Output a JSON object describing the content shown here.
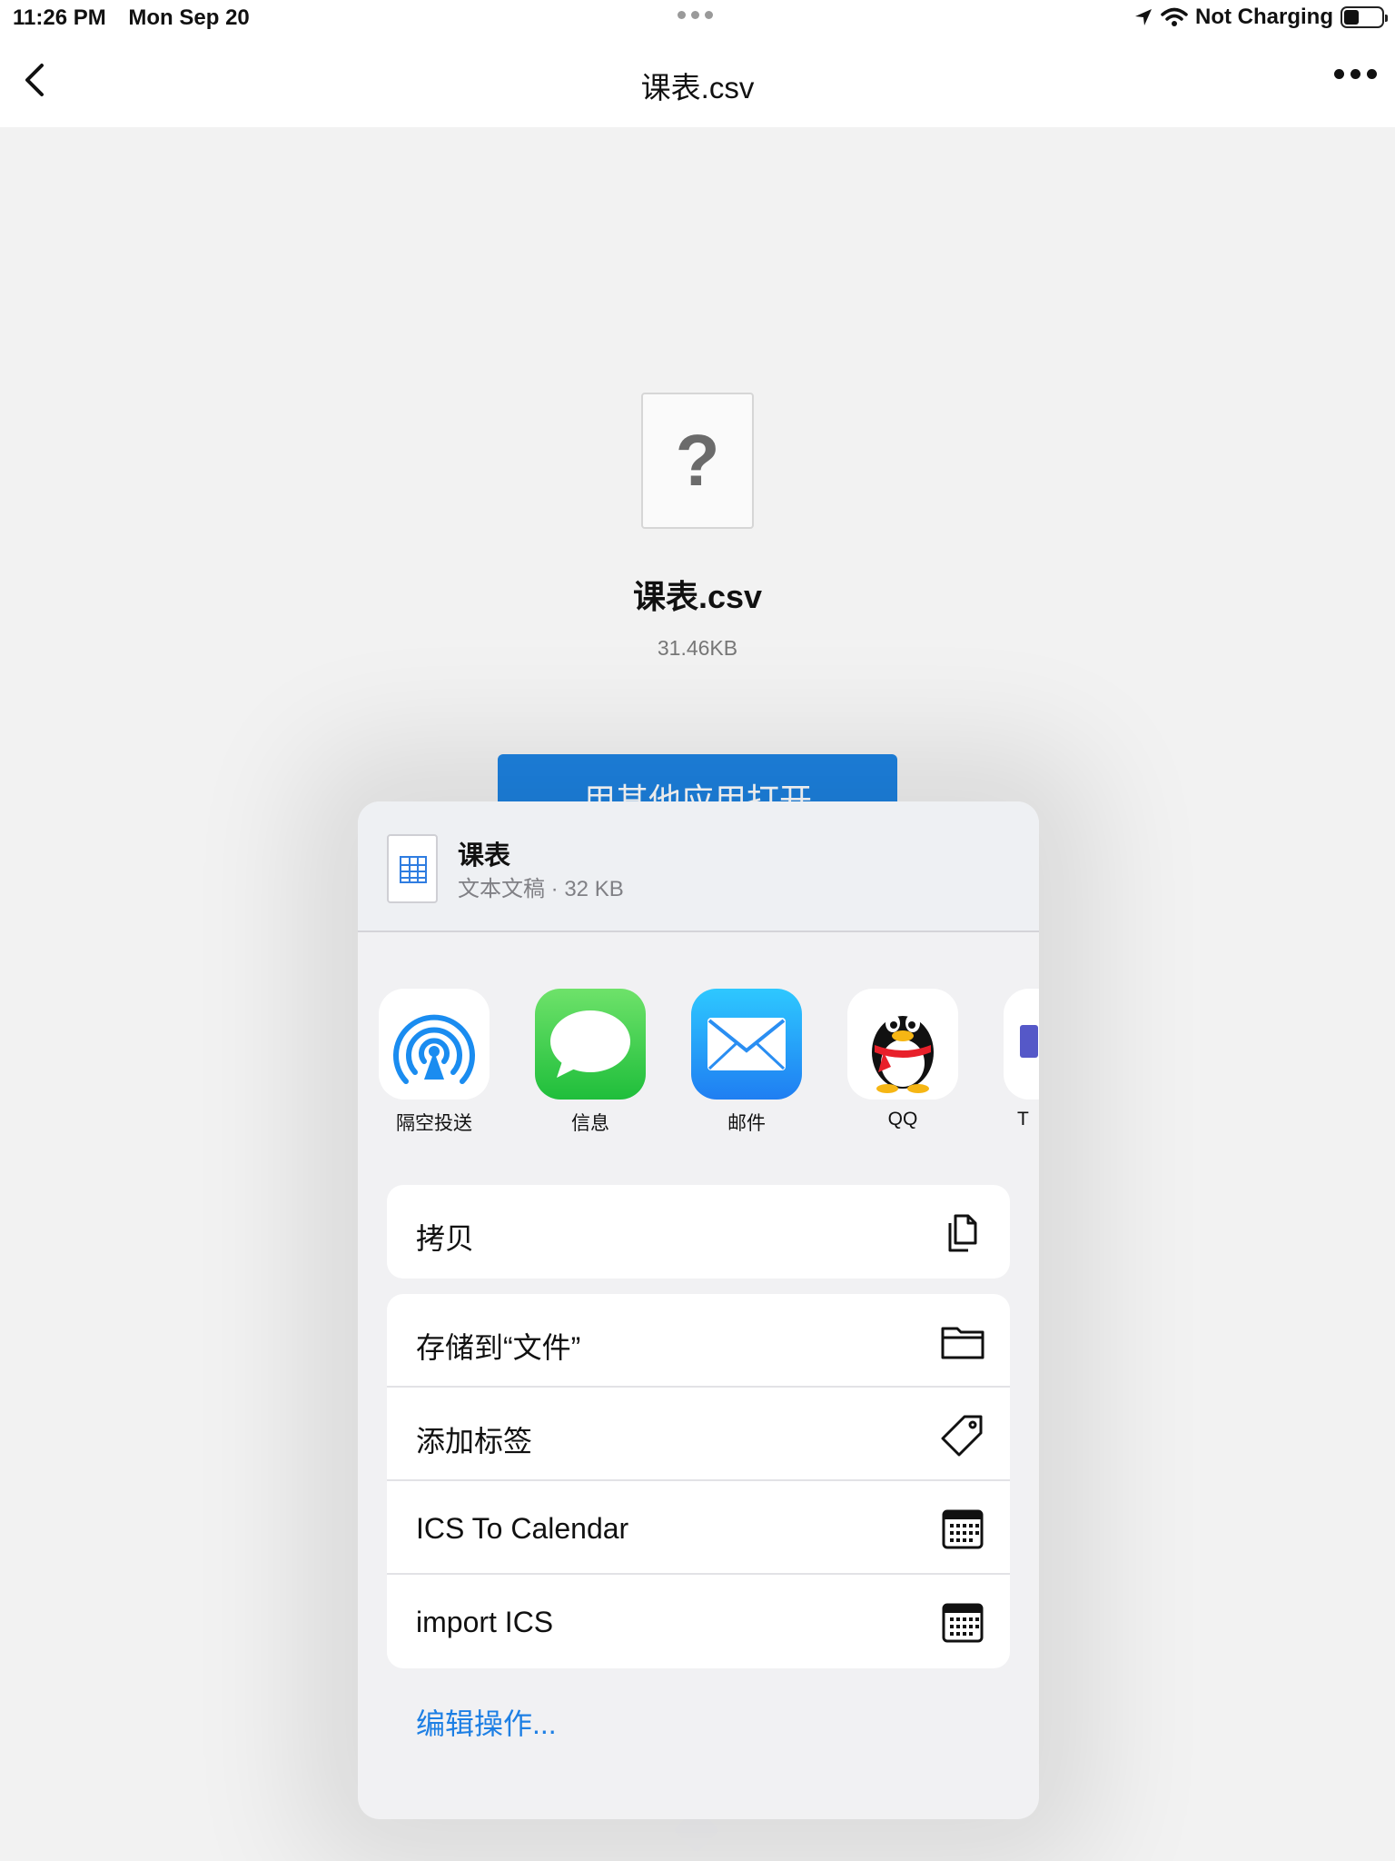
{
  "status_bar": {
    "time": "11:26 PM",
    "date": "Mon Sep 20",
    "battery_text": "Not Charging"
  },
  "nav": {
    "title": "课表.csv"
  },
  "file": {
    "placeholder_glyph": "?",
    "name": "课表.csv",
    "size": "31.46KB",
    "open_with_label": "用其他应用打开"
  },
  "share_sheet": {
    "doc_title": "课表",
    "doc_subtitle": "文本文稿 · 32 KB",
    "apps": [
      {
        "label": "隔空投送",
        "icon": "airdrop-icon"
      },
      {
        "label": "信息",
        "icon": "messages-icon"
      },
      {
        "label": "邮件",
        "icon": "mail-icon"
      },
      {
        "label": "QQ",
        "icon": "qq-icon"
      },
      {
        "label": "T",
        "icon": "app-icon"
      }
    ],
    "action_groups": [
      [
        {
          "label": "拷贝",
          "icon": "copy-icon"
        }
      ],
      [
        {
          "label": "存储到“文件”",
          "icon": "folder-icon"
        },
        {
          "label": "添加标签",
          "icon": "tag-icon"
        },
        {
          "label": "ICS To Calendar",
          "icon": "calendar-icon"
        },
        {
          "label": "import ICS",
          "icon": "calendar-icon"
        }
      ]
    ],
    "edit_actions_label": "编辑操作..."
  },
  "colors": {
    "accent": "#1d82e0",
    "background": "#f2f2f2",
    "sheet": "#f1f1f3"
  }
}
